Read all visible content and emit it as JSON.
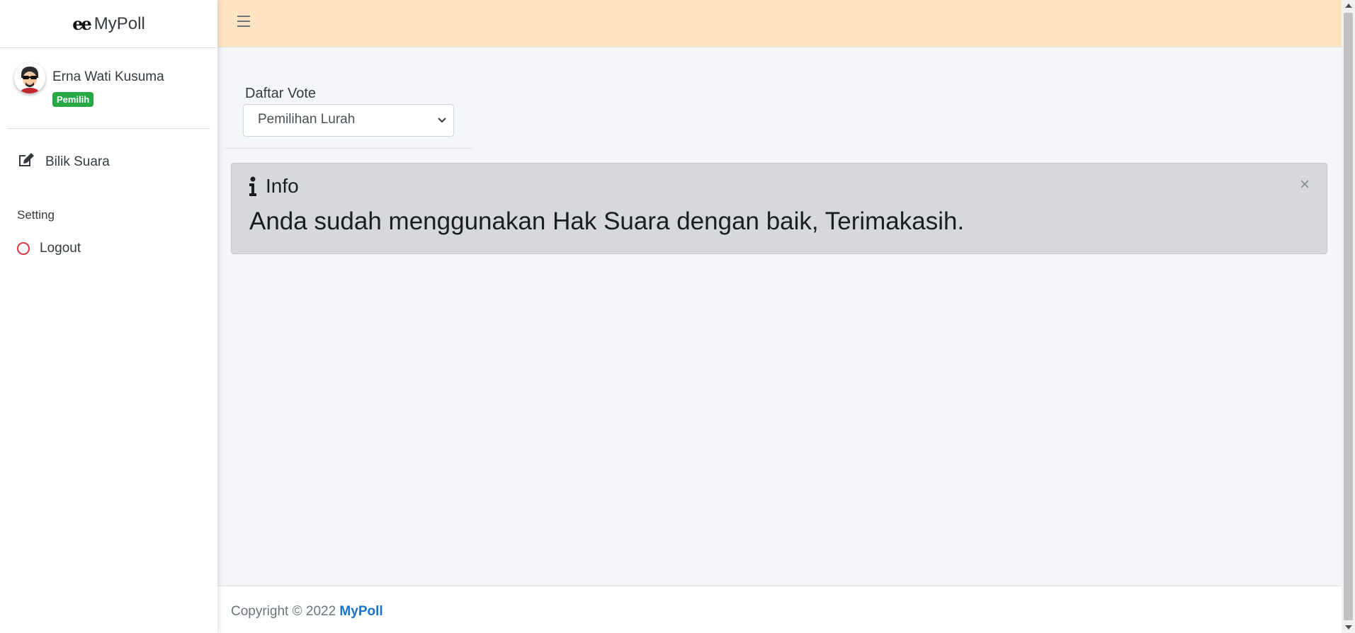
{
  "brand": {
    "logo": "ee",
    "name": "MyPoll"
  },
  "user": {
    "name": "Erna Wati Kusuma",
    "role_badge": "Pemilih"
  },
  "sidebar": {
    "items": [
      {
        "label": "Bilik Suara",
        "icon": "edit-icon"
      }
    ],
    "header": "Setting",
    "logout": {
      "label": "Logout",
      "icon": "circle-icon"
    }
  },
  "content": {
    "form_label": "Daftar Vote",
    "select_value": "Pemilihan Lurah",
    "alert": {
      "title": "Info",
      "message": "Anda sudah menggunakan Hak Suara dengan baik, Terimakasih.",
      "close": "×"
    }
  },
  "footer": {
    "text": "Copyright © 2022",
    "link": "MyPoll"
  },
  "colors": {
    "navbar_bg": "#ffe4c4",
    "badge_bg": "#28a745",
    "alert_bg": "#d6d8db",
    "link": "#1a73c9",
    "logout_icon": "#dc3545"
  }
}
